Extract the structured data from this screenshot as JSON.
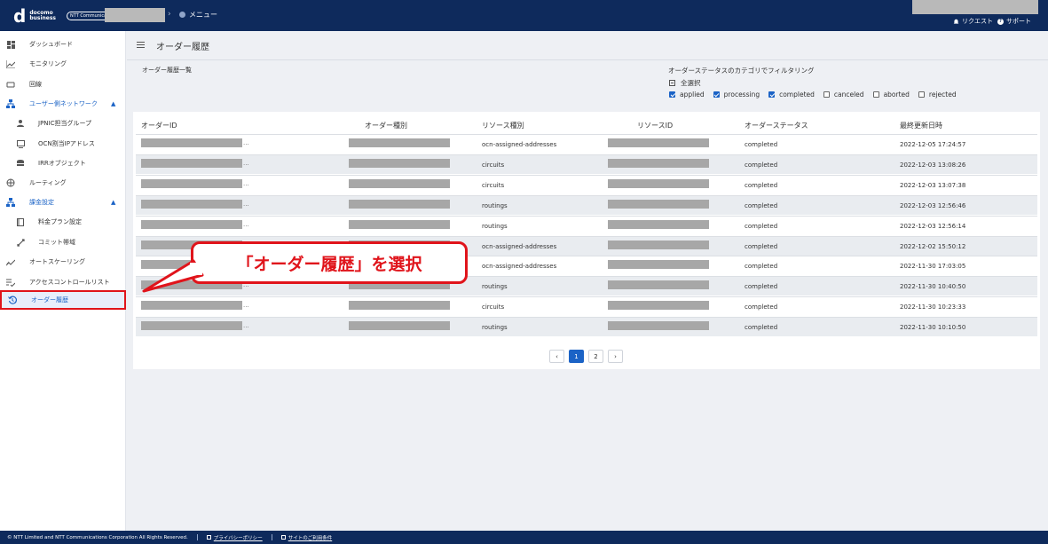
{
  "header": {
    "logo_line1": "docomo",
    "logo_line2": "business",
    "logo_ntt": "NTT Communications",
    "menu_label": "メニュー",
    "request_label": "リクエスト",
    "support_label": "サポート"
  },
  "sidebar": {
    "items": [
      {
        "label": "ダッシュボード",
        "icon": "dashboard-icon"
      },
      {
        "label": "モニタリング",
        "icon": "chart-icon"
      },
      {
        "label": "回線",
        "icon": "circuit-icon"
      },
      {
        "label": "ユーザー側ネットワーク",
        "icon": "network-icon"
      },
      {
        "label": "JPNIC担当グループ",
        "icon": "person-icon"
      },
      {
        "label": "OCN割当IPアドレス",
        "icon": "address-icon"
      },
      {
        "label": "IRRオブジェクト",
        "icon": "database-icon"
      },
      {
        "label": "ルーティング",
        "icon": "routing-icon"
      },
      {
        "label": "課金設定",
        "icon": "billing-icon"
      },
      {
        "label": "料金プラン設定",
        "icon": "plan-icon"
      },
      {
        "label": "コミット帯域",
        "icon": "commit-icon"
      },
      {
        "label": "オートスケーリング",
        "icon": "autoscale-icon"
      },
      {
        "label": "アクセスコントロールリスト",
        "icon": "acl-icon"
      },
      {
        "label": "オーダー履歴",
        "icon": "history-icon"
      }
    ]
  },
  "page": {
    "title": "オーダー履歴",
    "list_title": "オーダー履歴一覧",
    "filter_title": "オーダーステータスのカテゴリでフィルタリング",
    "select_all": "全選択",
    "filters": [
      {
        "label": "applied",
        "checked": true
      },
      {
        "label": "processing",
        "checked": true
      },
      {
        "label": "completed",
        "checked": true
      },
      {
        "label": "canceled",
        "checked": false
      },
      {
        "label": "aborted",
        "checked": false
      },
      {
        "label": "rejected",
        "checked": false
      }
    ]
  },
  "table": {
    "columns": [
      "オーダーID",
      "オーダー種別",
      "リソース種別",
      "リソースID",
      "オーダーステータス",
      "最終更新日時"
    ],
    "rows": [
      {
        "resource_type": "ocn-assigned-addresses",
        "status": "completed",
        "updated": "2022-12-05 17:24:57"
      },
      {
        "resource_type": "circuits",
        "status": "completed",
        "updated": "2022-12-03 13:08:26"
      },
      {
        "resource_type": "circuits",
        "status": "completed",
        "updated": "2022-12-03 13:07:38"
      },
      {
        "resource_type": "routings",
        "status": "completed",
        "updated": "2022-12-03 12:56:46"
      },
      {
        "resource_type": "routings",
        "status": "completed",
        "updated": "2022-12-03 12:56:14"
      },
      {
        "resource_type": "ocn-assigned-addresses",
        "status": "completed",
        "updated": "2022-12-02 15:50:12"
      },
      {
        "resource_type": "ocn-assigned-addresses",
        "status": "completed",
        "updated": "2022-11-30 17:03:05"
      },
      {
        "resource_type": "routings",
        "status": "completed",
        "updated": "2022-11-30 10:40:50"
      },
      {
        "resource_type": "circuits",
        "status": "completed",
        "updated": "2022-11-30 10:23:33"
      },
      {
        "resource_type": "routings",
        "status": "completed",
        "updated": "2022-11-30 10:10:50"
      }
    ],
    "masked_suffix": "..."
  },
  "pagination": {
    "prev": "‹",
    "pages": [
      "1",
      "2"
    ],
    "current": "1",
    "next": "›"
  },
  "callout": {
    "text": "「オーダー履歴」を選択"
  },
  "footer": {
    "copyright": "© NTT Limited and NTT Communications Corporation All Rights Reserved.",
    "privacy": "プライバシーポリシー",
    "terms": "サイトのご利用条件"
  },
  "colors": {
    "header_bg": "#0e2a5c",
    "accent": "#1b63c6",
    "highlight": "#e0141b"
  }
}
